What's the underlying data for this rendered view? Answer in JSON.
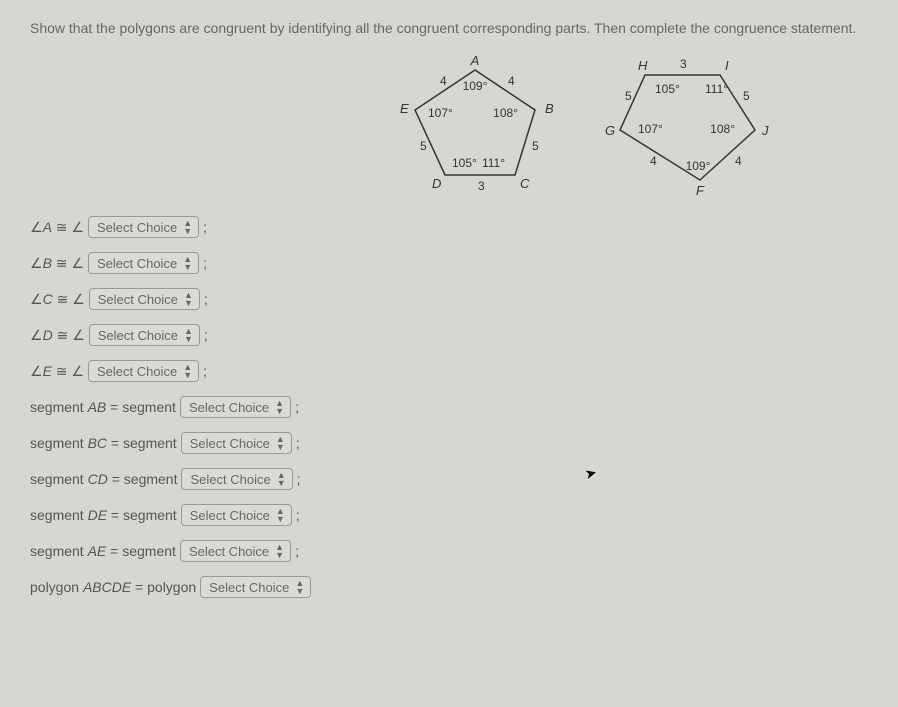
{
  "instruction": "Show that the polygons are congruent by identifying all the congruent corresponding parts. Then complete the congruence statement.",
  "select_placeholder": "Select Choice",
  "angle_rows": [
    {
      "label": "A"
    },
    {
      "label": "B"
    },
    {
      "label": "C"
    },
    {
      "label": "D"
    },
    {
      "label": "E"
    }
  ],
  "segment_rows": [
    {
      "label": "AB"
    },
    {
      "label": "BC"
    },
    {
      "label": "CD"
    },
    {
      "label": "DE"
    },
    {
      "label": "AE"
    }
  ],
  "polygon_row": {
    "label": "ABCDE"
  },
  "pentagon1": {
    "vertices": {
      "A": "A",
      "B": "B",
      "C": "C",
      "D": "D",
      "E": "E"
    },
    "angles": {
      "A": "109°",
      "B": "108°",
      "C": "111°",
      "D": "105°",
      "E": "107°"
    },
    "sides": {
      "EA": "4",
      "AB": "4",
      "BC": "5",
      "CD": "3",
      "DE": "5"
    }
  },
  "pentagon2": {
    "vertices": {
      "H": "H",
      "I": "I",
      "J": "J",
      "F": "F",
      "G": "G"
    },
    "angles": {
      "H": "105°",
      "I": "111°",
      "J": "108°",
      "F": "109°",
      "G": "107°"
    },
    "sides": {
      "HI": "3",
      "IJ": "5",
      "JF": "4",
      "FG": "4",
      "GH": "5"
    }
  },
  "chart_data": [
    {
      "type": "polygon",
      "name": "ABCDE",
      "vertices": [
        "A",
        "B",
        "C",
        "D",
        "E"
      ],
      "interior_angles_deg": {
        "A": 109,
        "B": 108,
        "C": 111,
        "D": 105,
        "E": 107
      },
      "side_lengths": {
        "EA": 4,
        "AB": 4,
        "BC": 5,
        "CD": 3,
        "DE": 5
      }
    },
    {
      "type": "polygon",
      "name": "FGHIJ",
      "vertices": [
        "F",
        "G",
        "H",
        "I",
        "J"
      ],
      "interior_angles_deg": {
        "H": 105,
        "I": 111,
        "J": 108,
        "F": 109,
        "G": 107
      },
      "side_lengths": {
        "HI": 3,
        "IJ": 5,
        "JF": 4,
        "FG": 4,
        "GH": 5
      }
    }
  ]
}
